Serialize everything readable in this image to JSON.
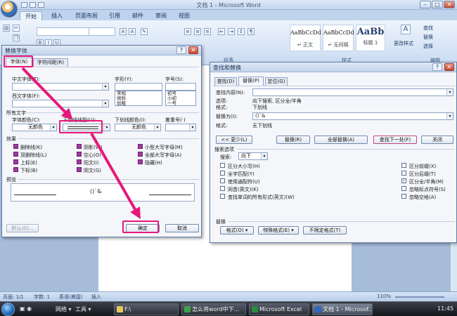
{
  "app": {
    "window_title": "文档 1 - Microsoft Word",
    "tabs": [
      "开始",
      "插入",
      "页面布局",
      "引用",
      "邮件",
      "审阅",
      "视图"
    ],
    "active_tab": "开始"
  },
  "ribbon": {
    "styles": [
      {
        "preview": "AaBbCcDd",
        "name": "↵ 正文"
      },
      {
        "preview": "AaBbCcDd",
        "name": "↵ 无间隔"
      },
      {
        "preview": "AaBb",
        "name": "标题 1"
      }
    ],
    "change_styles": "更改样式",
    "paragraph_label": "段落",
    "styles_label": "样式",
    "editing_label": "编辑",
    "find": "查找",
    "replace": "替换",
    "select": "选择"
  },
  "font_dialog": {
    "title": "替换字体",
    "tabs": [
      "字体(N)",
      "字符间距(R)"
    ],
    "labels": {
      "chinese_font": "中文字体(T):",
      "western_font": "西文字体(F):",
      "style": "字形(Y):",
      "size": "字号(S):",
      "all_text": "所有文字",
      "font_color": "字体颜色(C):",
      "underline_type": "下划线线型(U):",
      "underline_color": "下划线颜色(I):",
      "emphasis": "着重号(·)",
      "effects": "效果",
      "preview": "预览"
    },
    "values": {
      "font_color": "无颜色",
      "underline_color": "无颜色"
    },
    "style_list": [
      "常规",
      "倾斜",
      "加粗"
    ],
    "size_list": [
      "初号",
      "小初",
      "一号"
    ],
    "effects": [
      [
        "删除线(K)",
        "阴影(W)",
        "小型大写字母(M)"
      ],
      [
        "双删除线(L)",
        "空心(O)",
        "全部大写字母(A)"
      ],
      [
        "上标(E)",
        "阳文(I)",
        "隐藏(H)"
      ],
      [
        "下标(B)",
        "阴文(G)",
        ""
      ]
    ],
    "preview_text": "()`&",
    "buttons": {
      "default": "默认(D)...",
      "ok": "确定",
      "cancel": "取消"
    }
  },
  "find_replace_dialog": {
    "title": "查找和替换",
    "tabs": [
      "查找(D)",
      "替换(P)",
      "定位(G)"
    ],
    "find_label": "查找内容(N):",
    "options_label": "选项:",
    "options_value": "向下搜索, 区分全/半角",
    "format_label": "格式:",
    "find_format": "下划线",
    "replace_label": "替换为(I):",
    "replace_value": "()`&",
    "replace_format": "无下划线",
    "buttons": [
      "<< 更少(L)",
      "替换(R)",
      "全部替换(A)",
      "查找下一处(F)",
      "关闭"
    ],
    "search_options_title": "搜索选项",
    "search_label": "搜索:",
    "search_value": "向下",
    "left_options": [
      {
        "label": "区分大小写(H)",
        "checked": false
      },
      {
        "label": "全字匹配(Y)",
        "checked": false
      },
      {
        "label": "使用通配符(U)",
        "checked": false
      },
      {
        "label": "同音(英文)(K)",
        "checked": false
      },
      {
        "label": "查找单词的所有形式(英文)(W)",
        "checked": false
      }
    ],
    "right_options": [
      {
        "label": "区分前缀(X)",
        "checked": false
      },
      {
        "label": "区分后缀(T)",
        "checked": false
      },
      {
        "label": "区分全/半角(M)",
        "checked": true
      },
      {
        "label": "忽略标点符号(S)",
        "checked": false
      },
      {
        "label": "忽略空格(A)",
        "checked": false
      }
    ],
    "replace_section": "替换",
    "bottom_buttons": [
      "格式(O) ▾",
      "特殊格式(E) ▾",
      "不限定格式(T)"
    ]
  },
  "status_bar": {
    "page": "页面: 1/1",
    "words": "字数: 1",
    "language": "英语(美国)",
    "insert": "插入",
    "zoom": "110%"
  },
  "taskbar": {
    "items": [
      "网络 ▾",
      "工具 ▾",
      "F:\\",
      "怎么将word中下...",
      "Microsoft Excel",
      "文档 1 - Microsof..."
    ],
    "clock": "11:45"
  },
  "colors": {
    "highlight": "#e7187a",
    "title_gradient": "#c3d4ea",
    "accent": "#1c66b5"
  }
}
